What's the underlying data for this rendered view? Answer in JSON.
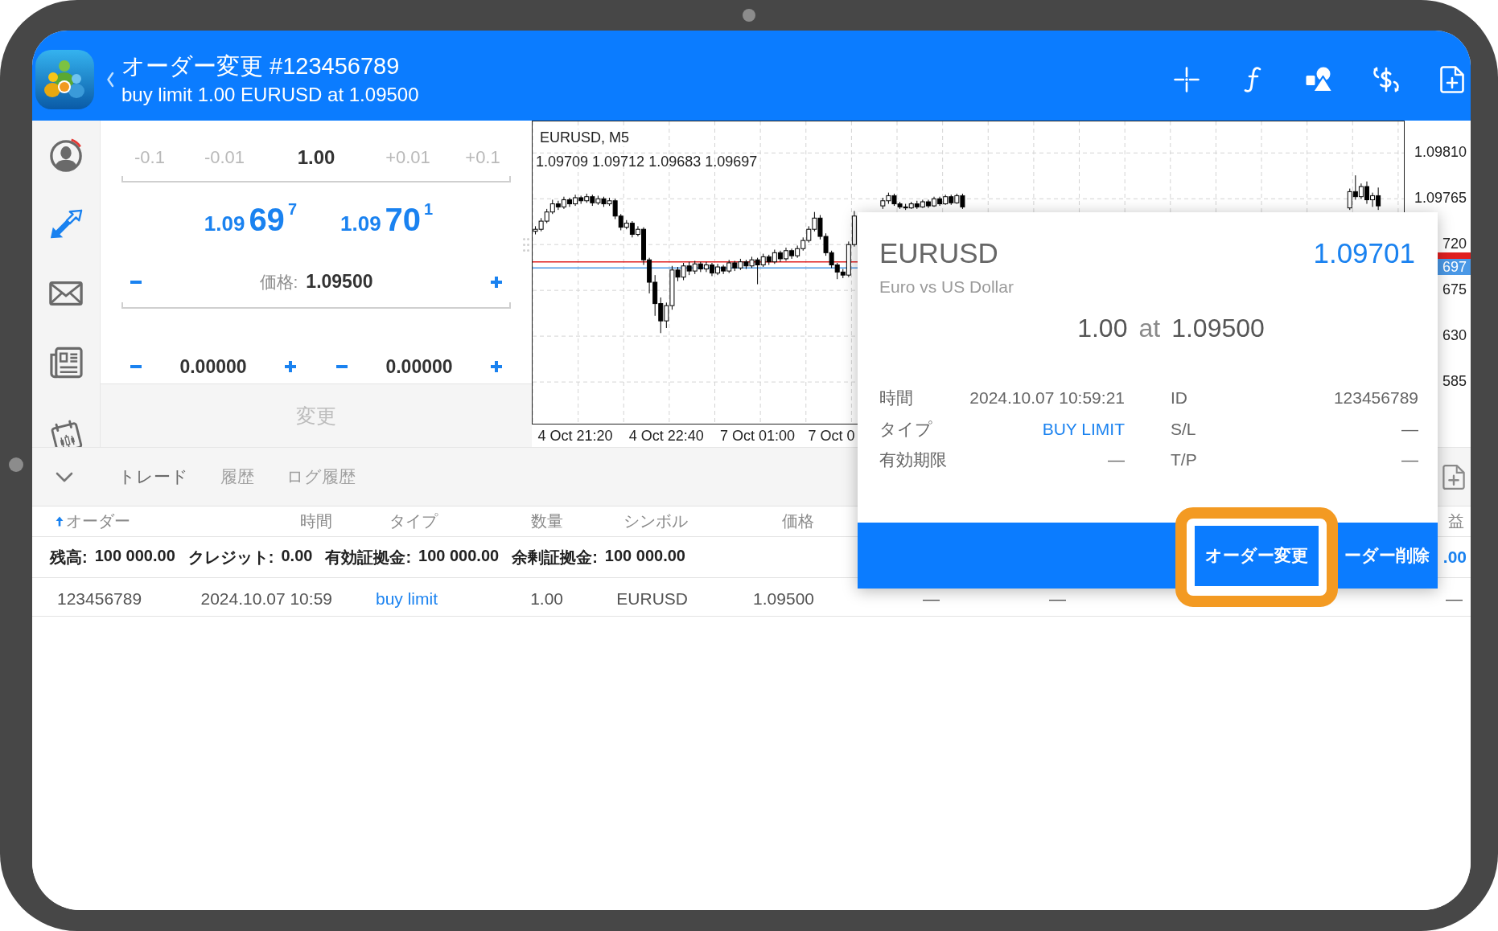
{
  "header": {
    "title": "オーダー変更 #123456789",
    "subtitle": "buy limit 1.00 EURUSD at 1.09500"
  },
  "sidebar": {
    "items": [
      {
        "kind": "account",
        "selected": false
      },
      {
        "kind": "trade",
        "selected": true
      },
      {
        "kind": "mail",
        "selected": false
      },
      {
        "kind": "news",
        "selected": false
      },
      {
        "kind": "calendar",
        "selected": false
      }
    ]
  },
  "order_form": {
    "volume": {
      "steps_down": [
        "-0.1",
        "-0.01"
      ],
      "value": "1.00",
      "steps_up": [
        "+0.01",
        "+0.1"
      ]
    },
    "quotes": [
      {
        "big_figure": "1.09",
        "pips": "69",
        "fraction": "7"
      },
      {
        "big_figure": "1.09",
        "pips": "70",
        "fraction": "1"
      }
    ],
    "price": {
      "label": "価格:",
      "value": "1.09500"
    },
    "stop_loss": {
      "value": "0.00000"
    },
    "take_profit": {
      "value": "0.00000"
    },
    "submit": {
      "label": "変更",
      "disabled": true
    }
  },
  "chart": {
    "quote_line": "1.09709 1.09712 1.09683 1.09697",
    "partial_price_labels": [
      "720",
      "675",
      "630",
      "585"
    ],
    "price_tag": "697",
    "chart_data": {
      "type": "candlestick",
      "title": "EURUSD, M5",
      "ylim": [
        1.09544,
        1.09841
      ],
      "yticks": [
        {
          "value": 1.0981,
          "label": "1.09810"
        },
        {
          "value": 1.09765,
          "label": "1.09765"
        }
      ],
      "ref_lines": [
        {
          "axis": "y",
          "value": 1.09703,
          "color": "#e02020"
        },
        {
          "axis": "y",
          "value": 1.09697,
          "color": "#4a98e6"
        }
      ],
      "categories": [
        null,
        null,
        null,
        null,
        null,
        null,
        null,
        "4 Oct 21:20",
        null,
        null,
        null,
        null,
        null,
        null,
        null,
        null,
        null,
        null,
        null,
        null,
        null,
        null,
        null,
        "4 Oct 22:40",
        null,
        null,
        null,
        null,
        null,
        null,
        null,
        null,
        null,
        null,
        null,
        null,
        null,
        null,
        null,
        "7 Oct 01:00",
        null,
        null,
        null,
        null,
        null,
        null,
        null,
        null,
        null,
        null,
        null,
        null,
        "7 Oct 0",
        null,
        null,
        null,
        null,
        null,
        null,
        null,
        null,
        null,
        null,
        null,
        null,
        null,
        null,
        null,
        null,
        null,
        null,
        null,
        null,
        null,
        null,
        null,
        null,
        null,
        null,
        null,
        null,
        null,
        null,
        null,
        null,
        null,
        null,
        null,
        null,
        null,
        null,
        null,
        null,
        null,
        null,
        null,
        null,
        null,
        null,
        null,
        null,
        null,
        null,
        null,
        null,
        null,
        null,
        null,
        null,
        null,
        null,
        null,
        null,
        null,
        null,
        null,
        null,
        null,
        null,
        null,
        null,
        null,
        null,
        null,
        null,
        null,
        null,
        null,
        null,
        null,
        null,
        null,
        null,
        null,
        null,
        null,
        null,
        null,
        null,
        null,
        null,
        null,
        null,
        null,
        null,
        null,
        null,
        null,
        null,
        null,
        null,
        null,
        null
      ],
      "ohlc": [
        [
          1.09733,
          1.09738,
          1.0973,
          1.09735
        ],
        [
          1.09735,
          1.09746,
          1.09733,
          1.09743
        ],
        [
          1.09743,
          1.09755,
          1.09741,
          1.09752
        ],
        [
          1.09752,
          1.09764,
          1.0975,
          1.0976
        ],
        [
          1.0976,
          1.09763,
          1.09754,
          1.09757
        ],
        [
          1.09757,
          1.09767,
          1.09755,
          1.09764
        ],
        [
          1.09764,
          1.09766,
          1.09757,
          1.0976
        ],
        [
          1.0976,
          1.09769,
          1.09758,
          1.09766
        ],
        [
          1.09766,
          1.09768,
          1.0976,
          1.09763
        ],
        [
          1.09763,
          1.0977,
          1.09761,
          1.09767
        ],
        [
          1.09767,
          1.09769,
          1.09758,
          1.09761
        ],
        [
          1.09761,
          1.09768,
          1.09759,
          1.09765
        ],
        [
          1.09765,
          1.09767,
          1.09757,
          1.0976
        ],
        [
          1.0976,
          1.09766,
          1.09758,
          1.09763
        ],
        [
          1.09763,
          1.09765,
          1.09745,
          1.09748
        ],
        [
          1.09748,
          1.0975,
          1.09734,
          1.09737
        ],
        [
          1.09737,
          1.09744,
          1.09735,
          1.09741
        ],
        [
          1.09741,
          1.09743,
          1.09727,
          1.0973
        ],
        [
          1.0973,
          1.09738,
          1.09728,
          1.09735
        ],
        [
          1.09735,
          1.09737,
          1.097,
          1.09705
        ],
        [
          1.09705,
          1.09707,
          1.09672,
          1.09683
        ],
        [
          1.09683,
          1.0969,
          1.0965,
          1.09662
        ],
        [
          1.09662,
          1.09668,
          1.09633,
          1.09645
        ],
        [
          1.09645,
          1.09663,
          1.09638,
          1.0966
        ],
        [
          1.0966,
          1.09699,
          1.09656,
          1.09695
        ],
        [
          1.09695,
          1.09698,
          1.09684,
          1.09688
        ],
        [
          1.09688,
          1.09702,
          1.09685,
          1.09699
        ],
        [
          1.09699,
          1.09703,
          1.0969,
          1.09694
        ],
        [
          1.09694,
          1.09704,
          1.09691,
          1.09701
        ],
        [
          1.09701,
          1.09703,
          1.09693,
          1.09696
        ],
        [
          1.09696,
          1.09703,
          1.09693,
          1.097
        ],
        [
          1.097,
          1.09702,
          1.09689,
          1.09692
        ],
        [
          1.09692,
          1.09701,
          1.0969,
          1.09698
        ],
        [
          1.09698,
          1.097,
          1.09691,
          1.09694
        ],
        [
          1.09694,
          1.09705,
          1.09692,
          1.09702
        ],
        [
          1.09702,
          1.09704,
          1.09694,
          1.09697
        ],
        [
          1.09697,
          1.09706,
          1.09695,
          1.09703
        ],
        [
          1.09703,
          1.09705,
          1.09696,
          1.09699
        ],
        [
          1.09699,
          1.09708,
          1.09697,
          1.09705
        ],
        [
          1.09705,
          1.09707,
          1.09681,
          1.097
        ],
        [
          1.097,
          1.09711,
          1.09698,
          1.09708
        ],
        [
          1.09708,
          1.0971,
          1.097,
          1.09703
        ],
        [
          1.09703,
          1.09715,
          1.09701,
          1.09712
        ],
        [
          1.09712,
          1.09714,
          1.09703,
          1.09706
        ],
        [
          1.09706,
          1.09717,
          1.09704,
          1.09714
        ],
        [
          1.09714,
          1.09716,
          1.09706,
          1.09709
        ],
        [
          1.09709,
          1.09719,
          1.09707,
          1.09716
        ],
        [
          1.09716,
          1.09727,
          1.09714,
          1.09724
        ],
        [
          1.09724,
          1.09738,
          1.09722,
          1.09735
        ],
        [
          1.09735,
          1.09752,
          1.09733,
          1.09746
        ],
        [
          1.09746,
          1.09749,
          1.09725,
          1.09728
        ],
        [
          1.09728,
          1.09731,
          1.09709,
          1.09712
        ],
        [
          1.09712,
          1.09714,
          1.09697,
          1.097
        ],
        [
          1.097,
          1.09702,
          1.09686,
          1.09693
        ],
        [
          1.09693,
          1.09696,
          1.09687,
          1.0969
        ],
        [
          1.0969,
          1.09723,
          1.09688,
          1.0972
        ],
        [
          1.0972,
          1.09753,
          1.09718,
          1.09748
        ],
        null,
        null,
        null,
        null,
        [
          1.09758,
          1.09766,
          1.09755,
          1.09763
        ],
        [
          1.09763,
          1.09771,
          1.0976,
          1.09768
        ],
        [
          1.09768,
          1.0977,
          1.09758,
          1.0976
        ],
        [
          1.0976,
          1.09762,
          1.09755,
          1.09757
        ],
        [
          1.09757,
          1.0976,
          1.09754,
          1.09756
        ],
        [
          1.09756,
          1.09762,
          1.09755,
          1.0976
        ],
        [
          1.0976,
          1.09763,
          1.09755,
          1.09757
        ],
        [
          1.09757,
          1.09764,
          1.09756,
          1.09762
        ],
        [
          1.09762,
          1.09764,
          1.09756,
          1.09758
        ],
        [
          1.09758,
          1.09767,
          1.09757,
          1.09765
        ],
        [
          1.09765,
          1.09767,
          1.09758,
          1.0976
        ],
        [
          1.0976,
          1.09769,
          1.09759,
          1.09767
        ],
        [
          1.09767,
          1.09769,
          1.09759,
          1.09761
        ],
        [
          1.09761,
          1.0977,
          1.0976,
          1.09768
        ],
        [
          1.09768,
          1.0977,
          1.09755,
          1.09757
        ],
        null,
        null,
        null,
        null,
        null,
        null,
        null,
        null,
        null,
        null,
        null,
        null,
        null,
        null,
        null,
        null,
        null,
        null,
        null,
        null,
        null,
        null,
        null,
        null,
        null,
        null,
        null,
        null,
        null,
        null,
        null,
        null,
        null,
        null,
        null,
        null,
        null,
        null,
        null,
        null,
        null,
        null,
        null,
        null,
        null,
        null,
        null,
        null,
        null,
        null,
        null,
        null,
        null,
        null,
        null,
        null,
        null,
        null,
        null,
        null,
        null,
        null,
        null,
        null,
        null,
        null,
        null,
        [
          1.09756,
          1.09775,
          1.09754,
          1.09772
        ],
        [
          1.09772,
          1.09788,
          1.09764,
          1.09767
        ],
        [
          1.09767,
          1.0978,
          1.09765,
          1.09777
        ],
        [
          1.09777,
          1.09782,
          1.0976,
          1.09764
        ],
        [
          1.09764,
          1.09771,
          1.09757,
          1.09768
        ],
        [
          1.09768,
          1.09776,
          1.09754,
          1.09758
        ],
        null,
        null,
        null,
        null
      ]
    }
  },
  "terminal": {
    "tabs": [
      {
        "label": "トレード",
        "selected": true
      },
      {
        "label": "履歴",
        "selected": false
      },
      {
        "label": "ログ履歴",
        "selected": false
      }
    ],
    "columns": [
      {
        "label": "オーダー",
        "sorted": true
      },
      {
        "label": "時間",
        "sorted": false
      },
      {
        "label": "タイプ",
        "sorted": false
      },
      {
        "label": "数量",
        "sorted": false
      },
      {
        "label": "シンボル",
        "sorted": false
      },
      {
        "label": "価格",
        "sorted": false
      },
      null,
      null,
      {
        "label": "益",
        "sorted": false
      }
    ],
    "summary": [
      {
        "label": "残高:",
        "value": "100 000.00"
      },
      {
        "label": "クレジット:",
        "value": "0.00"
      },
      {
        "label": "有効証拠金:",
        "value": "100 000.00"
      },
      {
        "label": "余剰証拠金:",
        "value": "100 000.00"
      }
    ],
    "summary_profit": ".00",
    "rows": [
      {
        "cells": [
          "123456789",
          "2024.10.07 10:59",
          "buy limit",
          "1.00",
          "EURUSD",
          "1.09500",
          "—",
          "—",
          "—"
        ]
      }
    ]
  },
  "order_popup": {
    "symbol": "EURUSD",
    "price": "1.09701",
    "description": "Euro vs US Dollar",
    "volume": "1.00",
    "at": "at",
    "order_price": "1.09500",
    "details": [
      {
        "label": "時間",
        "value": "2024.10.07 10:59:21",
        "kind": "text"
      },
      {
        "label": "ID",
        "value": "123456789",
        "kind": "text"
      },
      {
        "label": "タイプ",
        "value": "BUY LIMIT",
        "kind": "order_type"
      },
      {
        "label": "S/L",
        "value": "—",
        "kind": "text"
      },
      {
        "label": "有効期限",
        "value": "—",
        "kind": "text"
      },
      {
        "label": "T/P",
        "value": "—",
        "kind": "text"
      }
    ],
    "actions": [
      {
        "label": "オーダー変更",
        "highlighted": true
      },
      {
        "label": "ーダー削除",
        "highlighted": false
      }
    ]
  }
}
